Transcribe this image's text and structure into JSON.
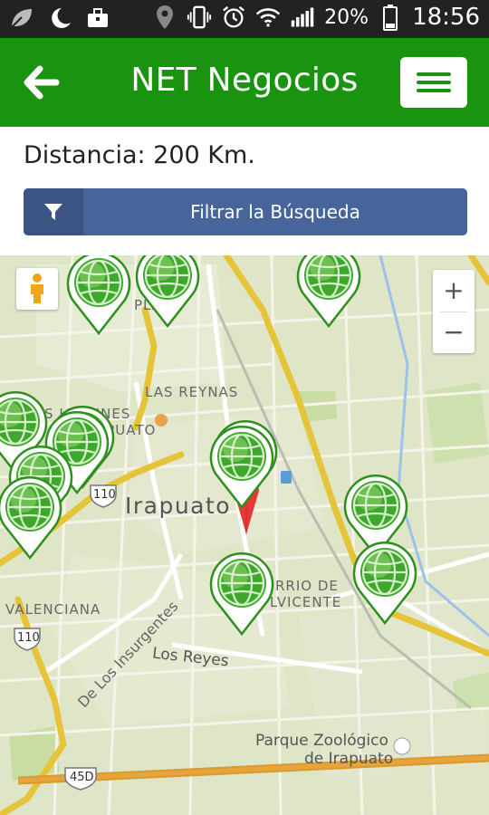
{
  "status_bar": {
    "battery": "20%",
    "time": "18:56",
    "icons": [
      "leaf-icon",
      "moon-icon",
      "briefcase-icon",
      "location-icon",
      "vibrate-icon",
      "alarm-icon",
      "wifi-icon",
      "signal-icon",
      "battery-icon"
    ]
  },
  "app_bar": {
    "title": "NET Negocios",
    "back_icon": "arrow-left-icon",
    "menu_icon": "hamburger-icon"
  },
  "distance": {
    "text": "Distancia: 200 Km."
  },
  "filter_button": {
    "label": "Filtrar la Búsqueda",
    "icon": "filter-icon"
  },
  "map": {
    "labels": {
      "las_reynas": "LAS REYNAS",
      "irapuato": "Irapuato",
      "valenciana": "VALENCIANA",
      "insurgentes": "De Los Insurgentes",
      "los_reyes": "Los Reyes",
      "barrio_line1": "RRIO DE",
      "barrio_line2": "LVICENTE",
      "jardines_line1": "NOS JARDINES",
      "jardines_line2": "APUATO",
      "plan": "PLA",
      "parque_line1": "Parque Zoológico",
      "parque_line2": "de Irapuato",
      "route_110_a": "110",
      "route_110_b": "110",
      "route_45d": "45D"
    },
    "zoom_in": "+",
    "zoom_out": "−",
    "marker_icon": "globe-pin-icon",
    "selected_marker_color": "#e53935",
    "marker_color": "#3ea82c"
  },
  "colors": {
    "app_bar": "#1a9410",
    "filter_button": "#48659b",
    "map_background": "#dfe6c8",
    "highway": "#e6c43a"
  }
}
